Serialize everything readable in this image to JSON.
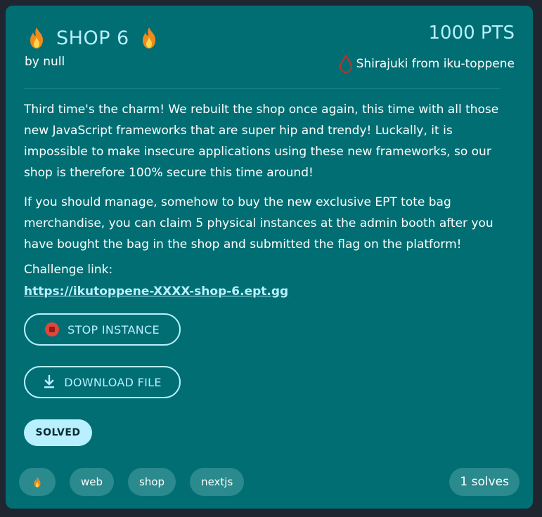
{
  "challenge": {
    "title": "SHOP 6",
    "author": "by null",
    "points": "1000 PTS",
    "first_blood": "Shirajuki from iku-toppene",
    "description": [
      "Third time's the charm! We rebuilt the shop once again, this time with all those new JavaScript frameworks that are super hip and trendy! Luckally, it is impossible to make insecure applications using these new frameworks, so our shop is therefore 100% secure this time around!",
      "If you should manage, somehow to buy the new exclusive EPT tote bag merchandise, you can claim 5 physical instances at the admin booth after you have bought the bag in the shop and submitted the flag on the platform!"
    ],
    "link_label": "Challenge link:",
    "link_url": "https://ikutoppene-XXXX-shop-6.ept.gg"
  },
  "actions": {
    "stop_label": "STOP INSTANCE",
    "download_label": "DOWNLOAD FILE"
  },
  "status": {
    "solved_label": "SOLVED"
  },
  "tags": [
    "web",
    "shop",
    "nextjs"
  ],
  "solves": "1 solves",
  "icons": {
    "title_left": "fire-icon",
    "title_right": "fire-icon",
    "first_blood": "blood-drop-icon",
    "stop": "stop-icon",
    "download": "download-icon",
    "tag_difficulty": "fire-icon"
  },
  "colors": {
    "card_bg": "#006e73",
    "accent": "#b8f0ff",
    "page_bg": "#1f2630",
    "tag_bg": "#2b8a8d",
    "stop_red": "#e0463c",
    "blood_red": "#c0302a"
  }
}
